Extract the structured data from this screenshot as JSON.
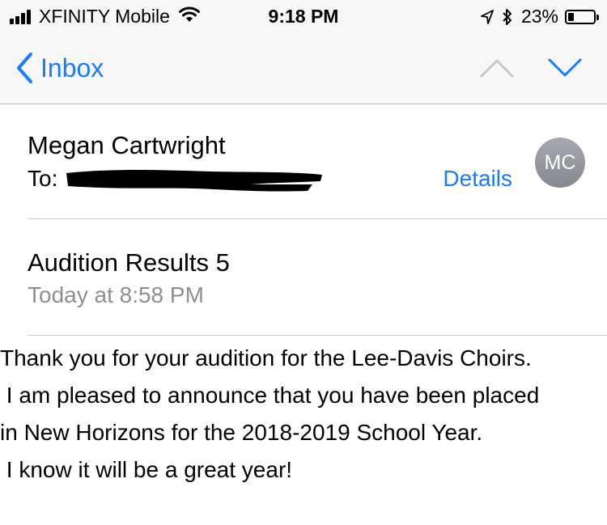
{
  "status_bar": {
    "carrier": "XFINITY Mobile",
    "time": "9:18 PM",
    "battery_percent": "23%",
    "battery_level": 0.23,
    "icons": [
      "signal-bars-icon",
      "wifi-icon",
      "location-arrow-icon",
      "bluetooth-icon",
      "battery-icon"
    ]
  },
  "nav": {
    "back_label": "Inbox",
    "icons": [
      "chevron-left-icon",
      "chevron-up-icon",
      "chevron-down-icon"
    ],
    "accent_color": "#1a7cf2",
    "disabled_color": "#c7c7cc"
  },
  "message": {
    "sender": "Megan Cartwright",
    "to_label": "To:",
    "details_label": "Details",
    "avatar_initials": "MC",
    "subject": "Audition Results 5",
    "date": "Today at 8:58 PM",
    "body_lines": [
      "Thank you for your audition for the Lee-Davis Choirs.",
      " I am pleased to announce that you have been placed",
      "in New Horizons for the 2018-2019 School Year.",
      " I know it will be a great year!"
    ]
  }
}
